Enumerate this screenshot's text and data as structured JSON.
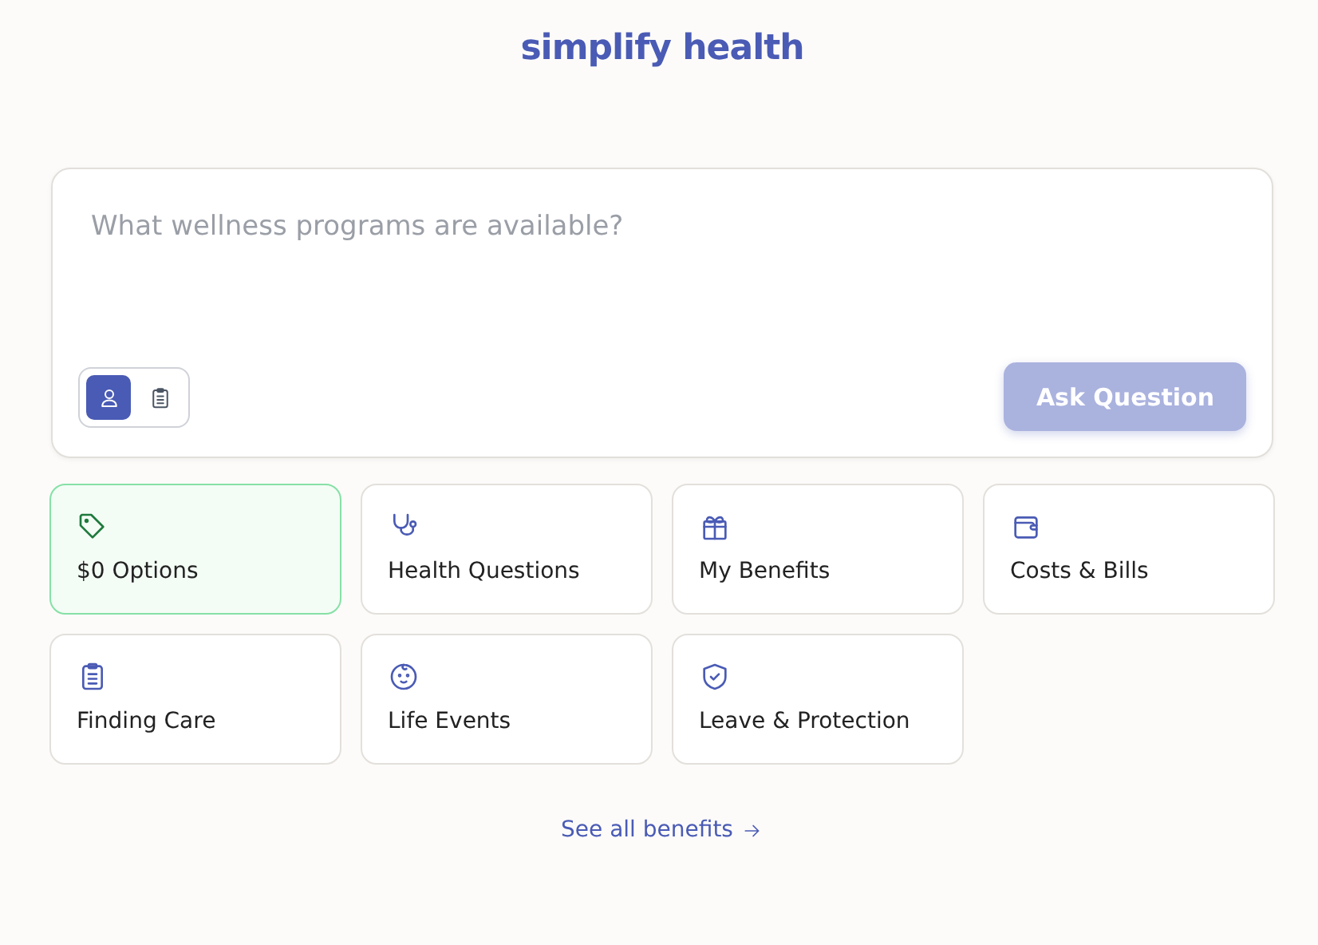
{
  "logo": "simplify health",
  "question": {
    "placeholder": "What wellness programs are available?",
    "modes": [
      {
        "kind": "person",
        "selected": true
      },
      {
        "kind": "clipboard",
        "selected": false
      }
    ],
    "submit": {
      "label": "Ask Question",
      "disabled": true
    }
  },
  "categories": [
    {
      "label": "$0 Options",
      "kind": "tag",
      "selected": true
    },
    {
      "label": "Health Questions",
      "kind": "stethoscope",
      "selected": false
    },
    {
      "label": "My Benefits",
      "kind": "gift",
      "selected": false
    },
    {
      "label": "Costs & Bills",
      "kind": "wallet",
      "selected": false
    },
    {
      "label": "Finding Care",
      "kind": "clipboard",
      "selected": false
    },
    {
      "label": "Life Events",
      "kind": "baby",
      "selected": false
    },
    {
      "label": "Leave & Protection",
      "kind": "shield",
      "selected": false
    }
  ],
  "link": {
    "label": "See all benefits"
  }
}
